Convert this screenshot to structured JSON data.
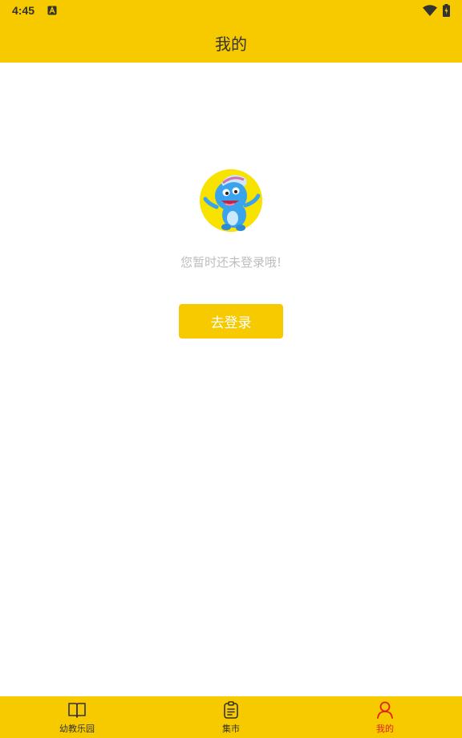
{
  "status_bar": {
    "time": "4:45",
    "notification_icon": "a-badge-icon",
    "wifi_icon": "wifi-icon",
    "battery_icon": "battery-charging-icon"
  },
  "header": {
    "title": "我的"
  },
  "main": {
    "avatar_icon": "mascot-avatar",
    "prompt": "您暂时还未登录哦!",
    "login_button": "去登录"
  },
  "bottom_nav": {
    "items": [
      {
        "label": "幼教乐园",
        "icon": "book-icon",
        "active": false
      },
      {
        "label": "集市",
        "icon": "clipboard-icon",
        "active": false
      },
      {
        "label": "我的",
        "icon": "user-icon",
        "active": true
      }
    ]
  },
  "colors": {
    "brand": "#f7ca00",
    "active_tab": "#e02020",
    "prompt_text": "#bdbdbd"
  }
}
